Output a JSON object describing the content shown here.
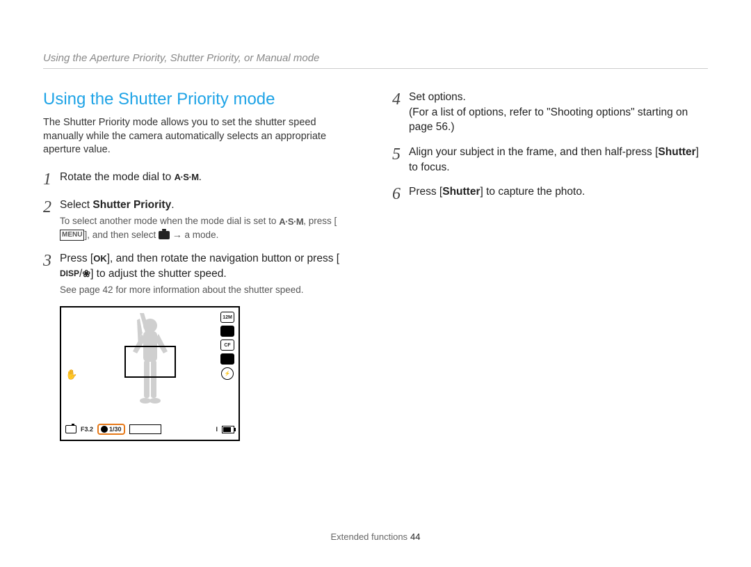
{
  "breadcrumb": "Using the Aperture Priority, Shutter Priority, or Manual mode",
  "heading": "Using the Shutter Priority mode",
  "intro": "The Shutter Priority mode allows you to set the shutter speed manually while the camera automatically selects an appropriate aperture value.",
  "icons": {
    "asm": "A·S·M",
    "menu": "MENU",
    "ok": "OK",
    "disp": "DISP",
    "flower": "❀",
    "arrow": "→"
  },
  "steps_left": [
    {
      "num": "1",
      "text_pre": "Rotate the mode dial to ",
      "append_asm": true,
      "text_post": "."
    },
    {
      "num": "2",
      "text_pre": "Select ",
      "bold": "Shutter Priority",
      "text_post": ".",
      "sub_pre": "To select another mode when the mode dial is set to ",
      "sub_asm": true,
      "sub_mid": ", press [",
      "sub_menu": true,
      "sub_mid2": "], and then select ",
      "sub_mode_glyph": true,
      "sub_arrow": true,
      "sub_post": " a mode."
    },
    {
      "num": "3",
      "text_pre": "Press [",
      "ok": true,
      "text_mid": "], and then rotate the navigation button or press [",
      "disp": true,
      "slash": "/",
      "flower": true,
      "text_post": "] to adjust the shutter speed.",
      "sub_plain": "See page 42 for more information about the shutter speed."
    }
  ],
  "steps_right": [
    {
      "num": "4",
      "line1": "Set options.",
      "line2": "(For a list of options, refer to \"Shooting options\" starting on page 56.)"
    },
    {
      "num": "5",
      "text_pre": "Align your subject in the frame, and then half-press [",
      "bold": "Shutter",
      "text_post": "] to focus."
    },
    {
      "num": "6",
      "text_pre": "Press [",
      "bold": "Shutter",
      "text_post": "] to capture the photo."
    }
  ],
  "display": {
    "aperture_label": "F3.2",
    "shutter_label": "1/30",
    "count_label": "I",
    "right_icons": [
      "12M",
      "",
      "CF",
      "",
      ""
    ]
  },
  "footer": {
    "section": "Extended functions",
    "page": "44"
  }
}
